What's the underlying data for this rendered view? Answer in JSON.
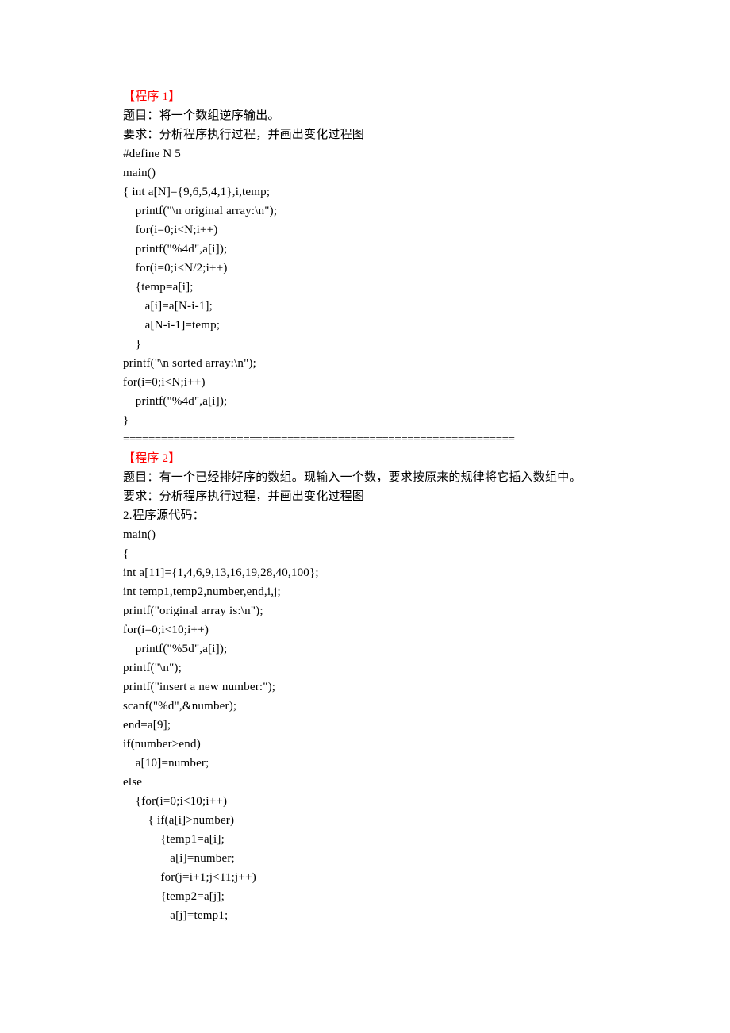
{
  "program1": {
    "heading": "【程序 1】",
    "lines": [
      "题目：将一个数组逆序输出。",
      "要求：分析程序执行过程，并画出变化过程图",
      "#define N 5",
      "main()",
      "{ int a[N]={9,6,5,4,1},i,temp;",
      "    printf(\"\\n original array:\\n\");",
      "    for(i=0;i<N;i++)",
      "    printf(\"%4d\",a[i]);",
      "    for(i=0;i<N/2;i++)",
      "    {temp=a[i];",
      "       a[i]=a[N-i-1];",
      "       a[N-i-1]=temp;",
      "    }",
      "printf(\"\\n sorted array:\\n\");",
      "for(i=0;i<N;i++)",
      "    printf(\"%4d\",a[i]);",
      "}"
    ]
  },
  "separator": "==============================================================",
  "program2": {
    "heading": "【程序 2】",
    "lines": [
      "题目：有一个已经排好序的数组。现输入一个数，要求按原来的规律将它插入数组中。",
      "要求：分析程序执行过程，并画出变化过程图",
      "2.程序源代码：",
      "main()",
      "{",
      "int a[11]={1,4,6,9,13,16,19,28,40,100};",
      "int temp1,temp2,number,end,i,j;",
      "printf(\"original array is:\\n\");",
      "for(i=0;i<10;i++)",
      "    printf(\"%5d\",a[i]);",
      "printf(\"\\n\");",
      "printf(\"insert a new number:\");",
      "scanf(\"%d\",&number);",
      "end=a[9];",
      "if(number>end)",
      "    a[10]=number;",
      "else",
      "    {for(i=0;i<10;i++)",
      "        { if(a[i]>number)",
      "            {temp1=a[i];",
      "               a[i]=number;",
      "            for(j=i+1;j<11;j++)",
      "            {temp2=a[j];",
      "               a[j]=temp1;"
    ]
  }
}
